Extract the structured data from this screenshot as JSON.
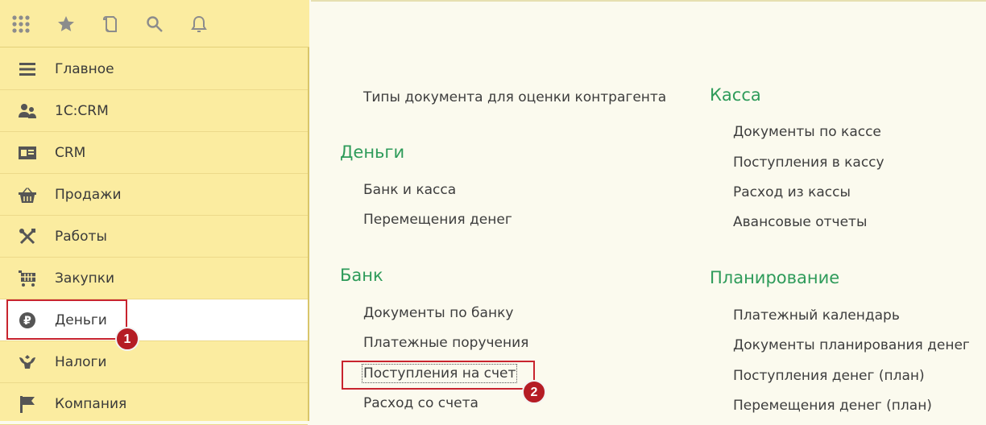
{
  "toolbar": {
    "icons": [
      "apps-grid-icon",
      "star-icon",
      "history-icon",
      "search-icon",
      "bell-icon"
    ]
  },
  "sidebar": {
    "items": [
      {
        "label": "Главное",
        "icon": "menu-icon"
      },
      {
        "label": "1С:CRM",
        "icon": "users-icon"
      },
      {
        "label": "CRM",
        "icon": "contact-card-icon"
      },
      {
        "label": "Продажи",
        "icon": "basket-icon"
      },
      {
        "label": "Работы",
        "icon": "tools-icon"
      },
      {
        "label": "Закупки",
        "icon": "cart-icon"
      },
      {
        "label": "Деньги",
        "icon": "ruble-icon",
        "active": true
      },
      {
        "label": "Налоги",
        "icon": "emblem-icon"
      },
      {
        "label": "Компания",
        "icon": "flag-icon"
      }
    ]
  },
  "content": {
    "left_column": {
      "top_link": "Типы документа для оценки контрагента",
      "sections": [
        {
          "title": "Деньги",
          "links": [
            "Банк и касса",
            "Перемещения денег"
          ]
        },
        {
          "title": "Банк",
          "links": [
            "Документы по банку",
            "Платежные поручения",
            "Поступления на счет",
            "Расход со счета"
          ]
        }
      ]
    },
    "right_column": {
      "sections": [
        {
          "title": "Касса",
          "links": [
            "Документы по кассе",
            "Поступления в кассу",
            "Расход из кассы",
            "Авансовые отчеты"
          ]
        },
        {
          "title": "Планирование",
          "links": [
            "Платежный календарь",
            "Документы планирования денег",
            "Поступления денег (план)",
            "Перемещения денег (план)"
          ]
        }
      ]
    }
  },
  "annotations": {
    "badge_1": "1",
    "badge_2": "2"
  },
  "colors": {
    "sidebar_bg": "#fbeca0",
    "section_title": "#2e9b5a",
    "highlight": "#c8242e"
  }
}
